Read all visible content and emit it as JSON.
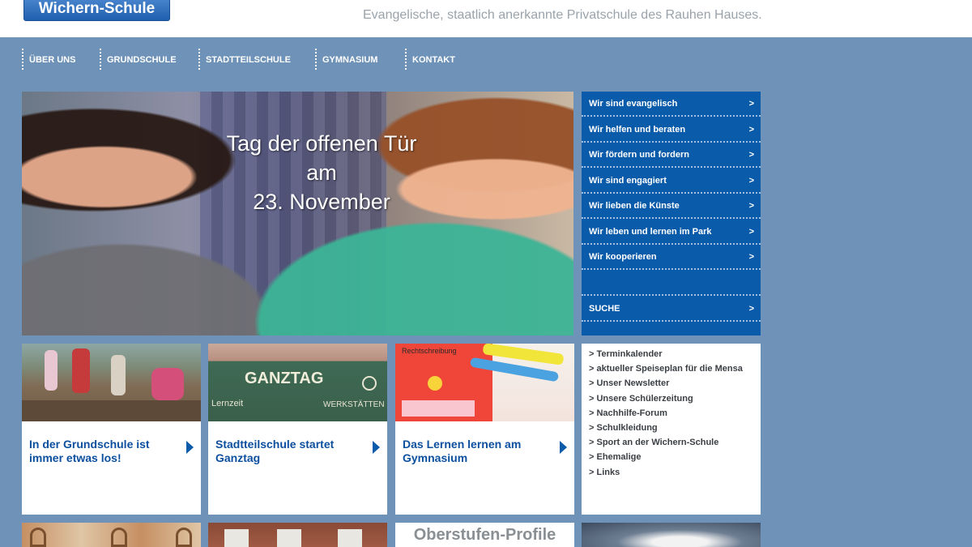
{
  "header": {
    "logo_text": "Wichern-Schule",
    "tagline": "Evangelische, staatlich anerkannte Privatschule des Rauhen Hauses."
  },
  "nav": [
    "ÜBER UNS",
    "GRUNDSCHULE",
    "STADTTEILSCHULE",
    "GYMNASIUM",
    "KONTAKT"
  ],
  "hero": {
    "line1": "Tag der offenen Tür",
    "line2": "am",
    "line3": "23. November"
  },
  "side_menu": {
    "items": [
      "Wir sind evangelisch",
      "Wir helfen und beraten",
      "Wir fördern und fordern",
      "Wir sind engagiert",
      "Wir lieben die Künste",
      "Wir leben und lernen im Park",
      "Wir kooperieren"
    ],
    "search_label": "SUCHE",
    "arrow": ">"
  },
  "cards": [
    {
      "title": "In der Grundschule ist immer etwas los!",
      "image": "children-playing-photo"
    },
    {
      "title": "Stadtteilschule startet Ganztag",
      "image": "ganztag-chalkboard-photo",
      "board_text": "GANZTAG",
      "board_sub": "Lernzeit",
      "board_sub2": "WERKSTÄTTEN"
    },
    {
      "title": "Das Lernen lernen am Gymnasium",
      "image": "highlighters-worksheet-photo",
      "sheet_text": "Rechtschreibung"
    }
  ],
  "quick_links": [
    "> Terminkalender",
    "> aktueller Speiseplan für die Mensa",
    "> Unser Newsletter",
    "> Unsere Schülerzeitung",
    "> Nachhilfe-Forum",
    "> Schulkleidung",
    "> Sport an der Wichern-Schule",
    "> Ehemalige",
    "> Links"
  ],
  "bottom_row": {
    "third_title": "Oberstufen-Profile"
  },
  "colors": {
    "background": "#6f93b8",
    "menu_blue": "#0b5bab",
    "title_blue": "#0b4f9e"
  }
}
